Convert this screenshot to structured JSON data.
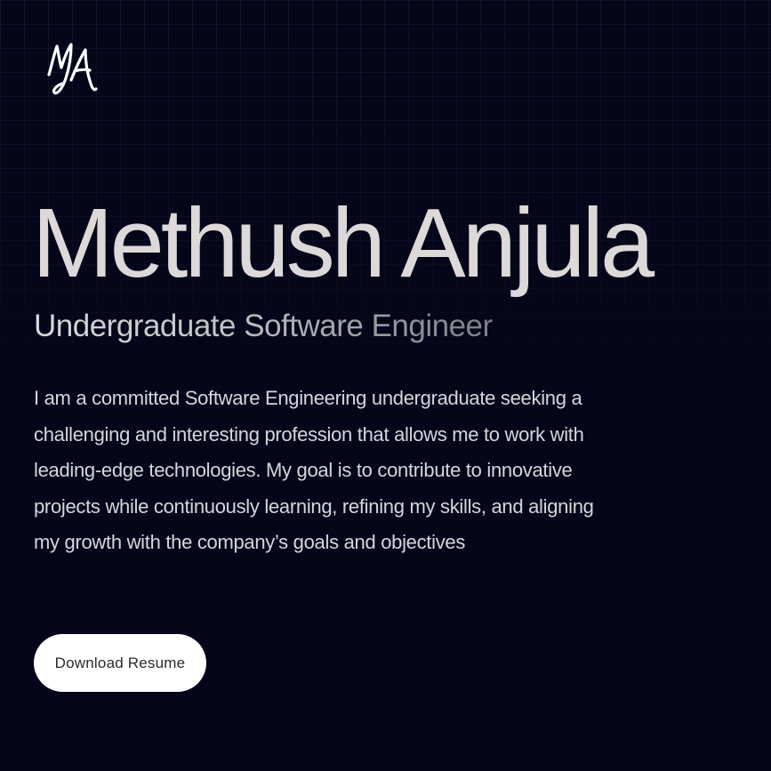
{
  "logo": {
    "icon": "ma-signature-logo-icon"
  },
  "hero": {
    "name": "Methush Anjula",
    "title": "Undergraduate Software Engineer",
    "bio": "I am a committed Software Engineering undergraduate seeking a challenging and interesting profession that allows me to work with leading-edge technologies. My goal is to contribute to innovative projects while continuously learning, refining my skills, and aligning my growth with the company’s goals and objectives",
    "resume_label": "Download Resume"
  },
  "colors": {
    "background": "#05061a",
    "text": "#dcd9d8",
    "button_bg": "#ffffff",
    "button_text": "#2a2a2e"
  }
}
